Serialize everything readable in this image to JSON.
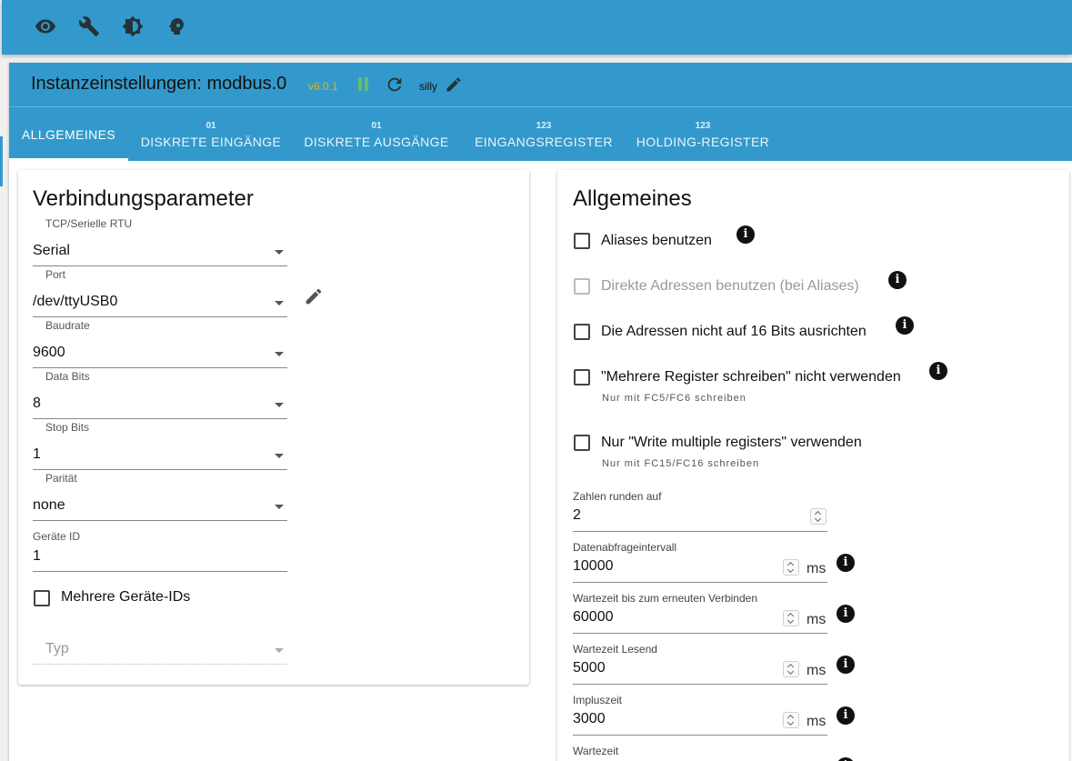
{
  "toolbar": {
    "icons": [
      "eye-icon",
      "wrench-icon",
      "brightness-icon",
      "head-icon"
    ]
  },
  "header": {
    "title": "Instanzeinstellungen: modbus.0",
    "version": "v6.0.1",
    "loglevel": "silly"
  },
  "tabs": [
    {
      "label": "ALLGEMEINES",
      "small": ""
    },
    {
      "label": "DISKRETE EINGÄNGE",
      "small": "01"
    },
    {
      "label": "DISKRETE AUSGÄNGE",
      "small": "01"
    },
    {
      "label": "EINGANGSREGISTER",
      "small": "123"
    },
    {
      "label": "HOLDING-REGISTER",
      "small": "123"
    }
  ],
  "left": {
    "title": "Verbindungsparameter",
    "connection": {
      "label": "TCP/Serielle RTU",
      "value": "Serial"
    },
    "port": {
      "label": "Port",
      "value": "/dev/ttyUSB0"
    },
    "baudrate": {
      "label": "Baudrate",
      "value": "9600"
    },
    "databits": {
      "label": "Data Bits",
      "value": "8"
    },
    "stopbits": {
      "label": "Stop Bits",
      "value": "1"
    },
    "parity": {
      "label": "Parität",
      "value": "none"
    },
    "deviceid": {
      "label": "Geräte ID",
      "value": "1"
    },
    "multi_ids": {
      "label": "Mehrere Geräte-IDs"
    },
    "type": {
      "placeholder": "Typ"
    }
  },
  "right": {
    "title": "Allgemeines",
    "checkboxes": [
      {
        "label": "Aliases benutzen",
        "help": ""
      },
      {
        "label": "Direkte Adressen benutzen (bei Aliases)",
        "help": ""
      },
      {
        "label": "Die Adressen nicht auf 16 Bits ausrichten",
        "help": ""
      },
      {
        "label": "\"Mehrere Register schreiben\" nicht verwenden",
        "help": "Nur mit FC5/FC6 schreiben"
      },
      {
        "label": "Nur \"Write multiple registers\" verwenden",
        "help": "Nur mit FC15/FC16 schreiben"
      }
    ],
    "round": {
      "label": "Zahlen runden auf",
      "value": "2"
    },
    "poll": {
      "label": "Datenabfrageintervall",
      "value": "10000",
      "unit": "ms"
    },
    "recon": {
      "label": "Wartezeit bis zum erneuten Verbinden",
      "value": "60000",
      "unit": "ms"
    },
    "readtime": {
      "label": "Wartezeit Lesend",
      "value": "5000",
      "unit": "ms"
    },
    "pulse": {
      "label": "Impluszeit",
      "value": "3000",
      "unit": "ms"
    },
    "wait": {
      "label": "Wartezeit"
    }
  }
}
